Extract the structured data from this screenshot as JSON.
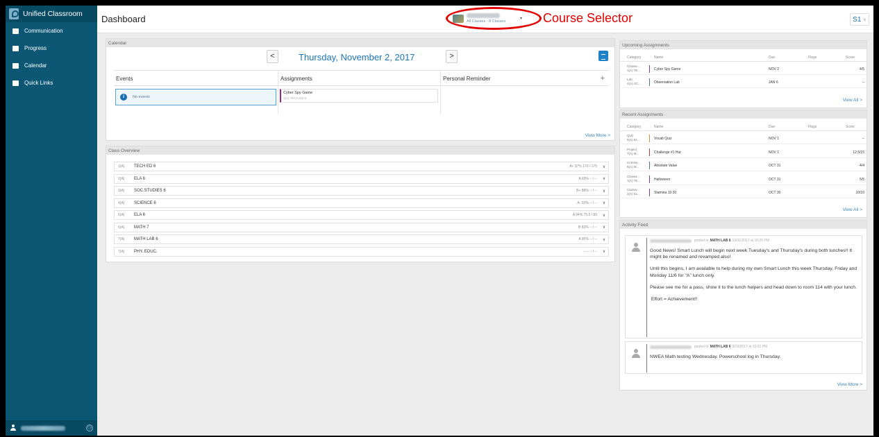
{
  "sidebar": {
    "brand": "Unified Classroom",
    "items": [
      {
        "label": "Communication",
        "icon": "list-icon"
      },
      {
        "label": "Progress",
        "icon": "clipboard-icon"
      },
      {
        "label": "Calendar",
        "icon": "calendar-icon"
      },
      {
        "label": "Quick Links",
        "icon": "link-icon"
      }
    ],
    "collapse_glyph": "◷"
  },
  "topbar": {
    "title": "Dashboard",
    "course_selector_sub": "All Classes - 8 Classes",
    "annotation": "Course Selector",
    "term": "S1",
    "colors": {
      "annotation": "#e20000",
      "accent": "#1a76b8"
    }
  },
  "calendar": {
    "section_title": "Calendar",
    "date": "Thursday, November 2, 2017",
    "prev": "<",
    "next": ">",
    "columns": [
      "Events",
      "Assignments",
      "Personal Reminder"
    ],
    "add": "+",
    "no_events": "No events",
    "assignment": {
      "name": "Cyber Spy Game",
      "sub": "1(A) TECH ED 6"
    },
    "view_more": "View More >"
  },
  "class_overview": {
    "section_title": "Class Overview",
    "rows": [
      {
        "period": "1(A)",
        "name": "TECH ED 6",
        "grade": "A+  97%  170 / 176"
      },
      {
        "period": "2(A)",
        "name": "ELA 6",
        "grade": "A  93%  -- / --"
      },
      {
        "period": "3(A)",
        "name": "SOC.STUDIES 6",
        "grade": "B+  88%  -- / --"
      },
      {
        "period": "4(A)",
        "name": "SCIENCE 6",
        "grade": "A-  92%  -- / --"
      },
      {
        "period": "5(A)",
        "name": "ELA 6",
        "grade": "A  94%  75.5 / 80"
      },
      {
        "period": "6(A)",
        "name": "MATH 7",
        "grade": "B  83%  -- / --"
      },
      {
        "period": "7(A)",
        "name": "MATH LAB 6",
        "grade": "A  95%  -- / --"
      },
      {
        "period": "7(A)",
        "name": "PHY. EDUC.",
        "grade": "--  --  -- / --"
      }
    ],
    "chevron": "∨"
  },
  "upcoming": {
    "section_title": "Upcoming Assignments",
    "headers": [
      "Category",
      "Name",
      "Due",
      "Flags",
      "Score"
    ],
    "rows": [
      {
        "category": "Classw...",
        "cat_sub": "1(A) TE...",
        "name": "Cyber Spy Game",
        "due": "NOV 2",
        "score": "4/5",
        "color": "#7a3d9c"
      },
      {
        "category": "Lab",
        "cat_sub": "4(A) SC...",
        "name": "Observation Lab",
        "due": "JAN 6",
        "score": "--",
        "color": "#4a6fa5"
      }
    ],
    "view_all": "View All >"
  },
  "recent": {
    "section_title": "Recent Assignments",
    "headers": [
      "Category",
      "Name",
      "Due",
      "Flags",
      "Score"
    ],
    "rows": [
      {
        "category": "Quiz",
        "cat_sub": "5(A) EL...",
        "name": "Vocab Quiz",
        "due": "NOV 1",
        "score": "--",
        "color": "#e08a3a"
      },
      {
        "category": "Project",
        "cat_sub": "7(A) M...",
        "name": "Challenge #1 Hut",
        "due": "NOV 1",
        "score": "12.5/15",
        "color": "#c0392b"
      },
      {
        "category": "Homew...",
        "cat_sub": "6(A) M...",
        "name": "Absolute Value",
        "due": "OCT 31",
        "score": "4/4",
        "color": "#4a6fa5"
      },
      {
        "category": "Classw...",
        "cat_sub": "1(A) TE...",
        "name": "Halloween",
        "due": "OCT 31",
        "score": "5/5",
        "color": "#7a3d9c"
      },
      {
        "category": "Classw...",
        "cat_sub": "2(A) EL...",
        "name": "Stamina 10:30",
        "due": "OCT 30",
        "score": "10/10",
        "color": "#7a3d9c"
      }
    ],
    "view_all": "View All >"
  },
  "activity": {
    "section_title": "Activity Feed",
    "items": [
      {
        "posted_prefix": "posted to",
        "course": "MATH LAB 6",
        "time": "10/31/2017 at 10:20 PM",
        "paragraphs": [
          "Good News! Smart Lunch will begin next week Tuesday's and Thursday's during both lunches!! It might be renamed and revamped also!",
          "Until this begins, I am available to help during my own Smart Lunch this week Thursday, Friday and Monday 11/6 for \"A\" lunch only.",
          "Please see me for a pass, show it to the lunch helpers and head down to room 114 with your lunch.",
          " Effort = Achievement!!"
        ]
      },
      {
        "posted_prefix": "posted to",
        "course": "MATH LAB 6",
        "time": "9/19/2017 at 10:02 PM",
        "paragraphs": [
          "NWEA Math testing Wednesday. Powerschool log in Thursday."
        ]
      }
    ],
    "view_more": "View More >"
  }
}
